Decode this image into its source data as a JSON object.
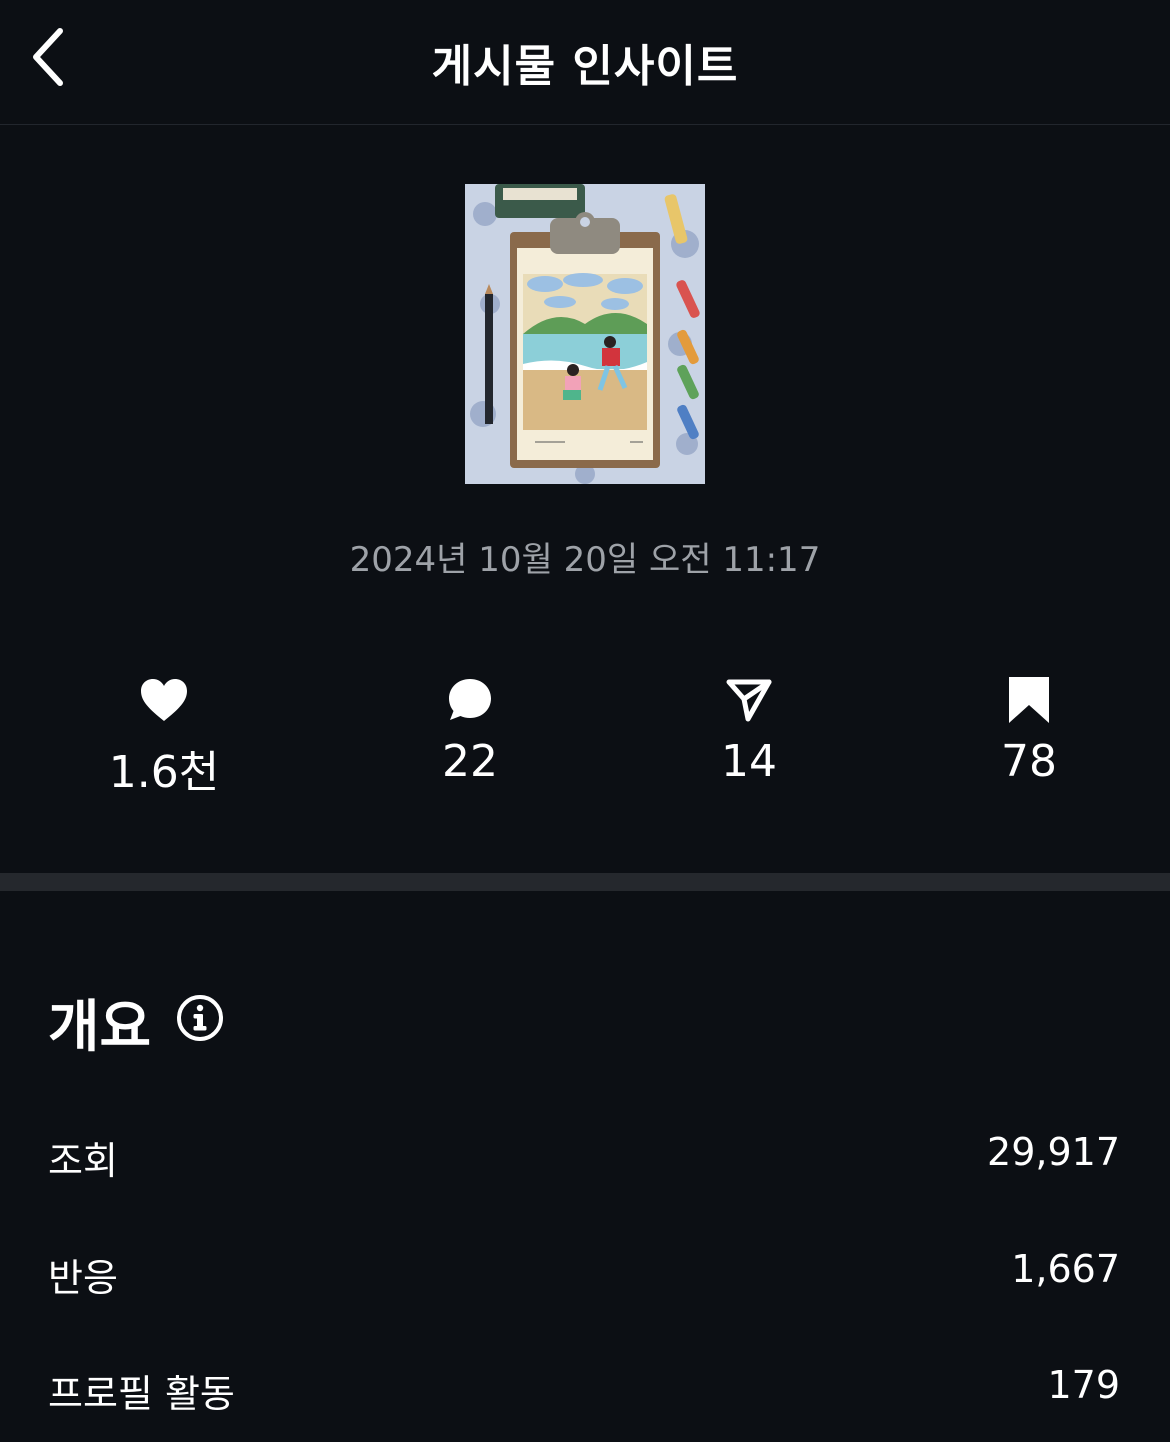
{
  "header": {
    "title": "게시물 인사이트"
  },
  "post": {
    "date": "2024년 10월 20일 오전 11:17"
  },
  "stats": [
    {
      "icon": "heart-icon",
      "value": "1.6천"
    },
    {
      "icon": "comment-icon",
      "value": "22"
    },
    {
      "icon": "share-icon",
      "value": "14"
    },
    {
      "icon": "bookmark-icon",
      "value": "78"
    }
  ],
  "overview": {
    "title": "개요",
    "rows": [
      {
        "label": "조회",
        "value": "29,917"
      },
      {
        "label": "반응",
        "value": "1,667"
      },
      {
        "label": "프로필 활동",
        "value": "179"
      }
    ]
  },
  "colors": {
    "background": "#0c0f14",
    "muted_text": "#9ea2a8",
    "divider": "#25282d"
  }
}
